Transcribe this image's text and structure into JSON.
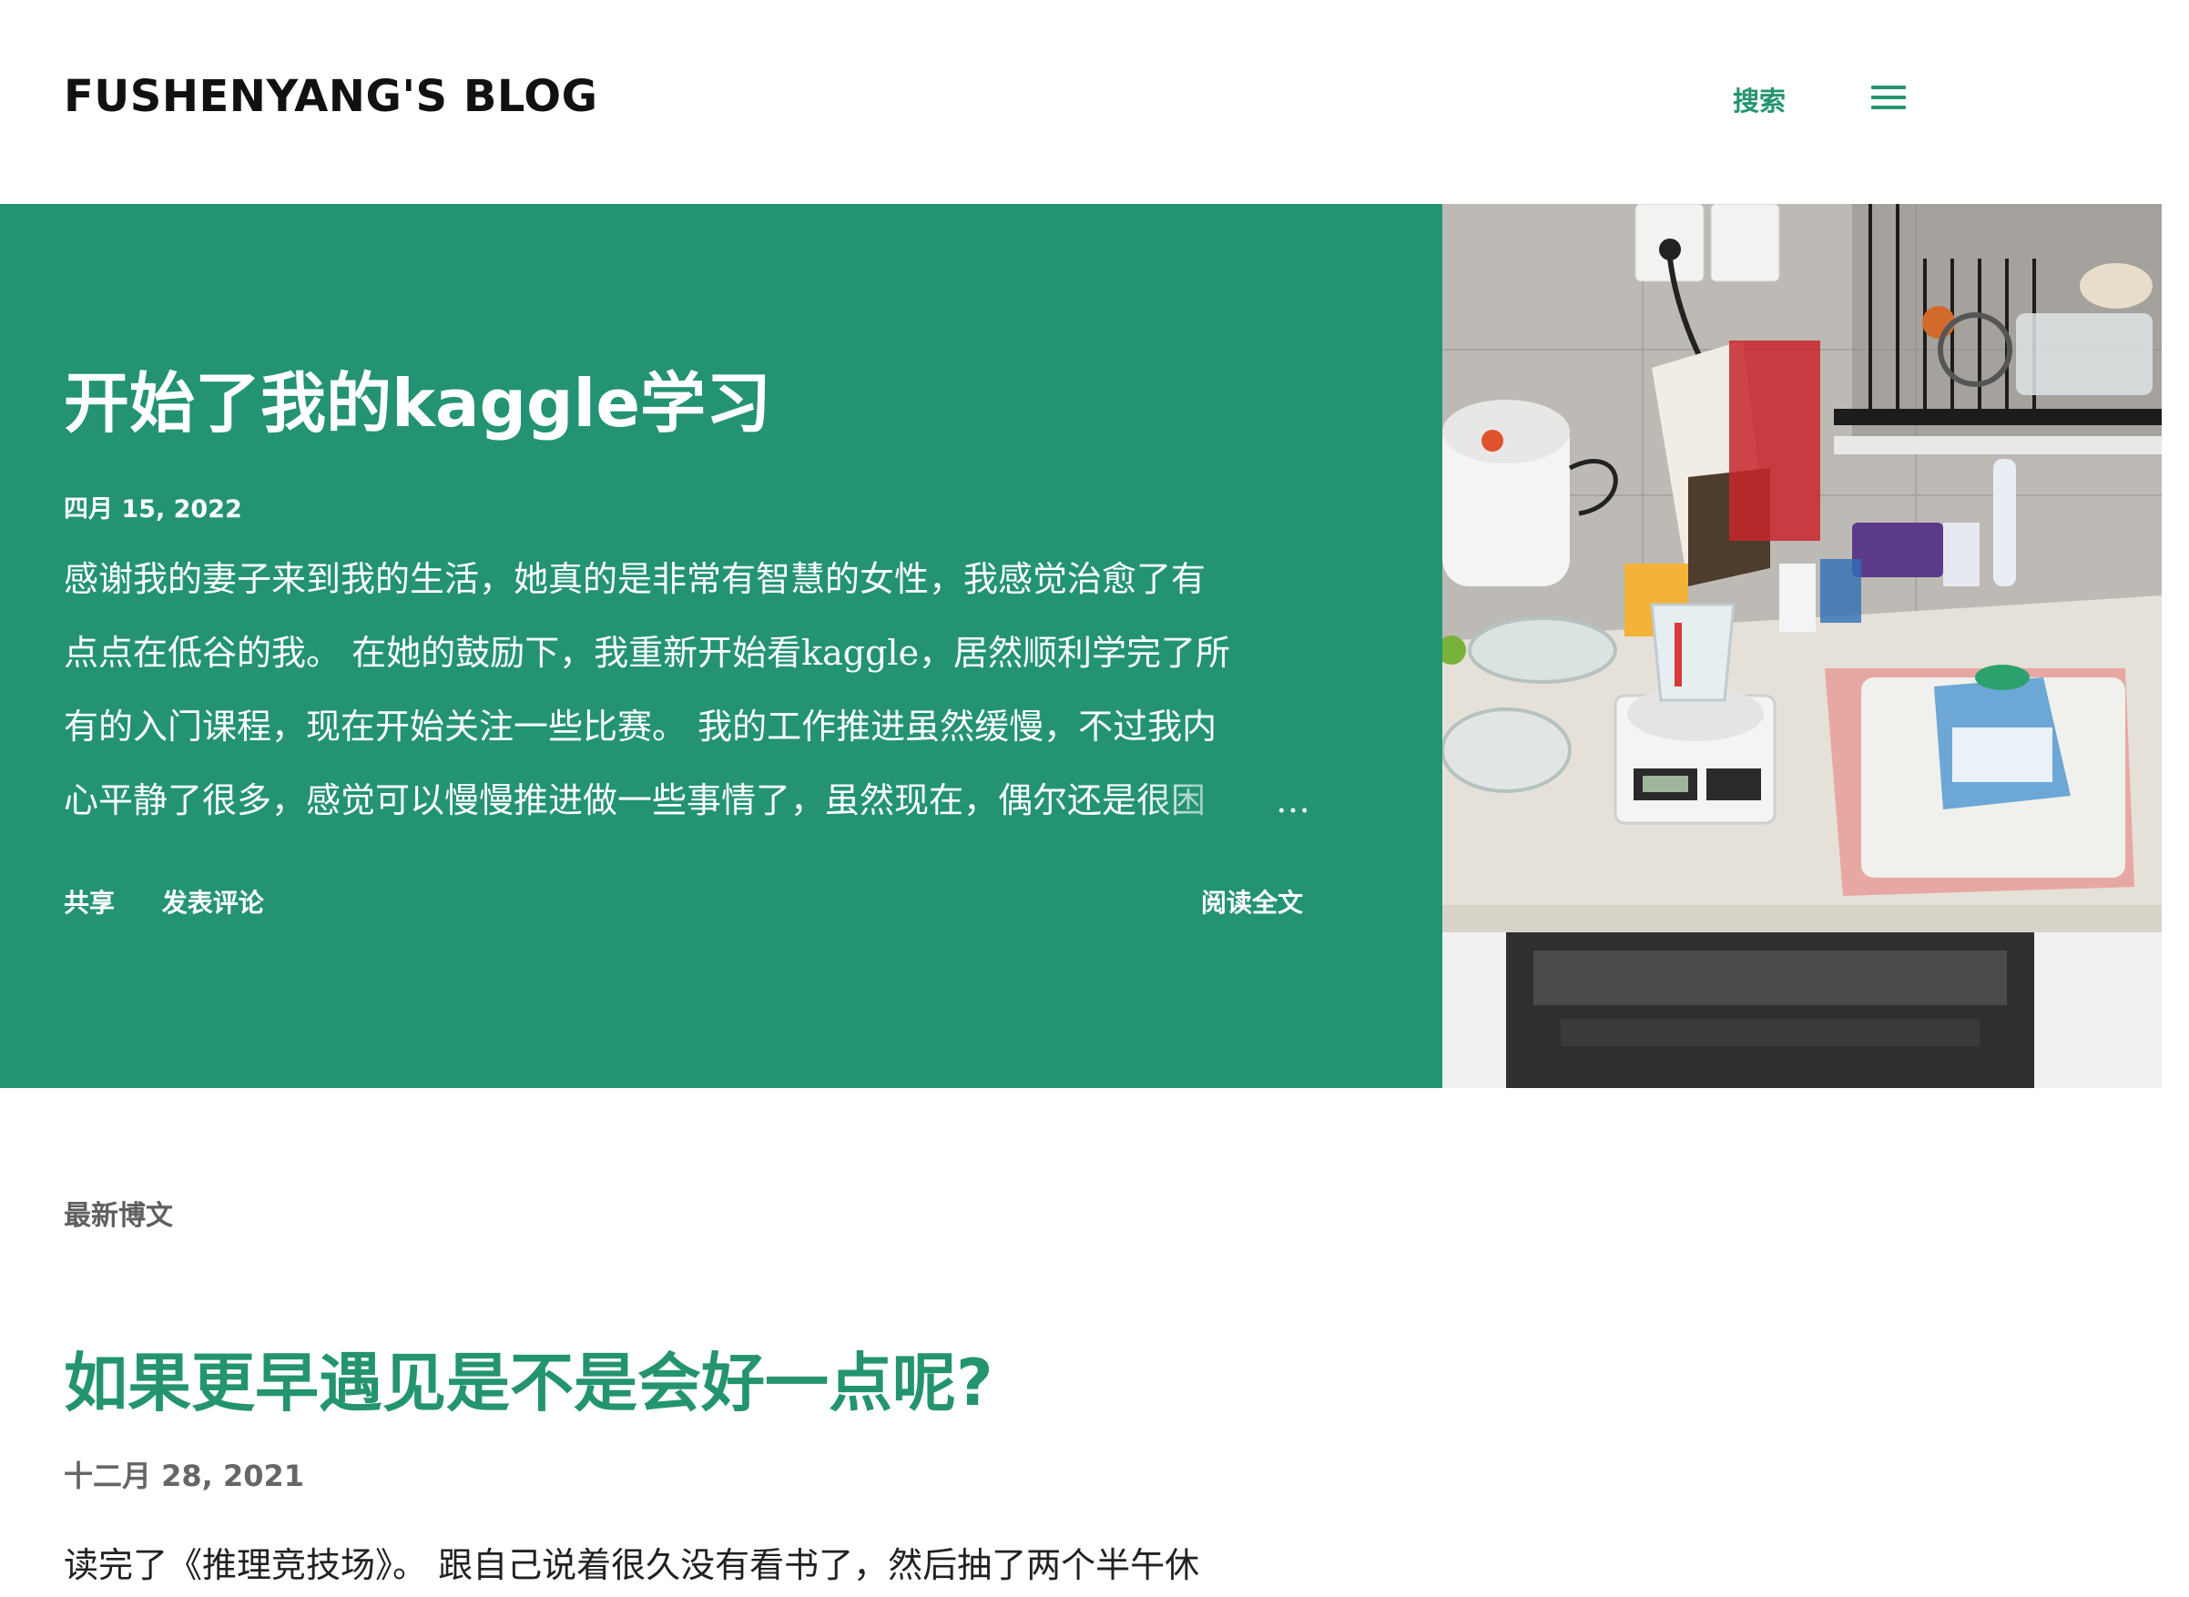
{
  "header": {
    "blog_title": "FUSHENYANG'S BLOG",
    "search_label": "搜索",
    "menu_icon": "hamburger-menu-icon"
  },
  "featured": {
    "title": "开始了我的kaggle学习",
    "date": "四月 15, 2022",
    "snippet_lines": [
      " 感谢我的妻子来到我的生活，她真的是非常有智慧的女性，我感觉治愈了有",
      "点点在低谷的我。 在她的鼓励下，我重新开始看kaggle，居然顺利学完了所",
      "有的入门课程，现在开始关注一些比赛。 我的工作推进虽然缓慢，不过我内",
      "心平静了很多，感觉可以慢慢推进做一些事情了，虽然现在，偶尔还是很困"
    ],
    "ellipsis": "…",
    "share_label": "共享",
    "comment_label": "发表评论",
    "read_more_label": "阅读全文",
    "image_alt": "kitchen-counter-photo",
    "background_color": "#239373"
  },
  "latest": {
    "heading": "最新博文",
    "posts": [
      {
        "title": "如果更早遇见是不是会好一点呢?",
        "date": "十二月 28, 2021",
        "snippet": "读完了《推理竞技场》。 跟自己说着很久没有看书了，然后抽了两个半午休"
      }
    ]
  },
  "colors": {
    "accent": "#24946f",
    "text": "#212121",
    "muted": "#666666"
  }
}
